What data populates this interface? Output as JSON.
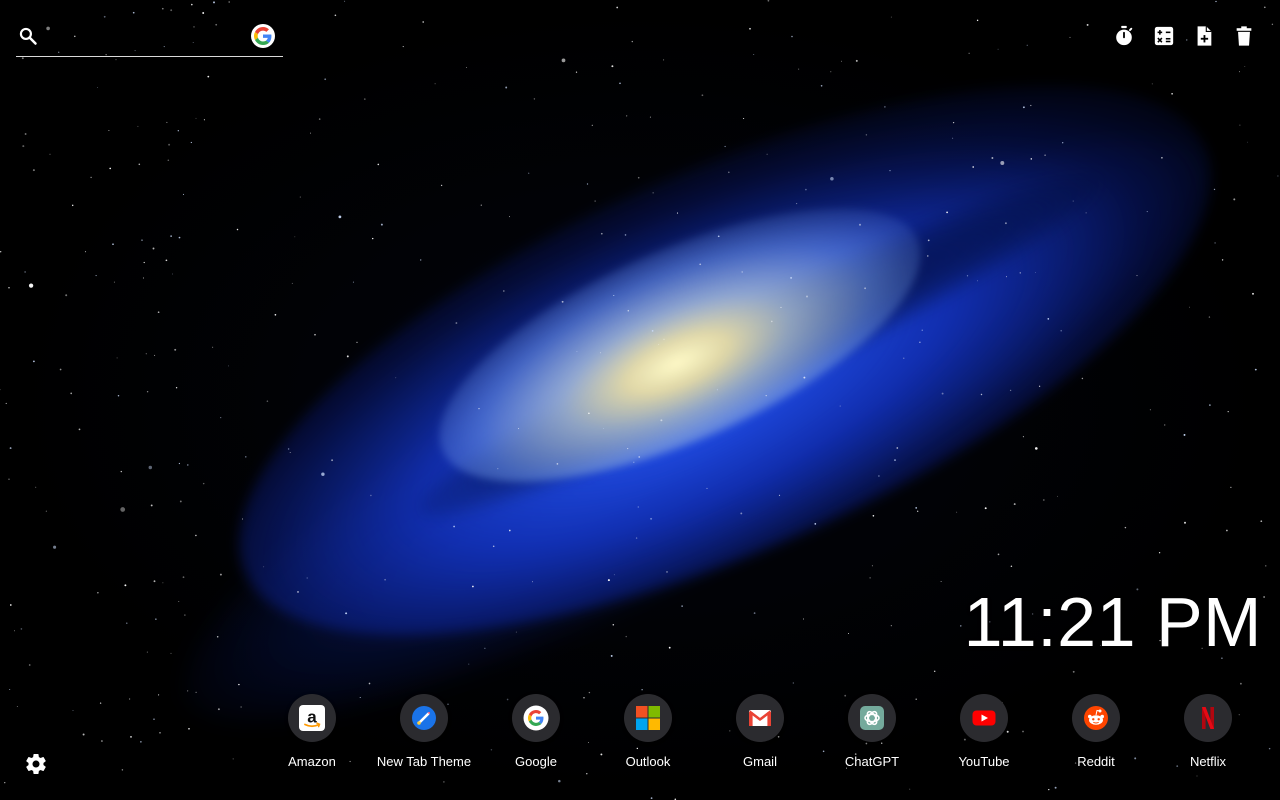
{
  "search": {
    "value": "",
    "placeholder": "",
    "engine_icon": "google-g-icon"
  },
  "toolbar": {
    "tools": [
      {
        "icon": "stopwatch-icon"
      },
      {
        "icon": "calculator-icon"
      },
      {
        "icon": "add-note-icon"
      },
      {
        "icon": "trash-icon"
      }
    ]
  },
  "clock": {
    "time": "11:21 PM"
  },
  "shortcuts": [
    {
      "label": "Amazon",
      "icon": "amazon-icon"
    },
    {
      "label": "New Tab Theme",
      "icon": "new-tab-theme-icon"
    },
    {
      "label": "Google",
      "icon": "google-icon"
    },
    {
      "label": "Outlook",
      "icon": "outlook-icon"
    },
    {
      "label": "Gmail",
      "icon": "gmail-icon"
    },
    {
      "label": "ChatGPT",
      "icon": "chatgpt-icon"
    },
    {
      "label": "YouTube",
      "icon": "youtube-icon"
    },
    {
      "label": "Reddit",
      "icon": "reddit-icon"
    },
    {
      "label": "Netflix",
      "icon": "netflix-icon"
    }
  ],
  "settings": {
    "icon": "gear-icon"
  },
  "colors": {
    "background": "#000000",
    "galaxy_blue": "#1e46dc",
    "tile_bg": "#2b2b2f",
    "text": "#ffffff"
  }
}
